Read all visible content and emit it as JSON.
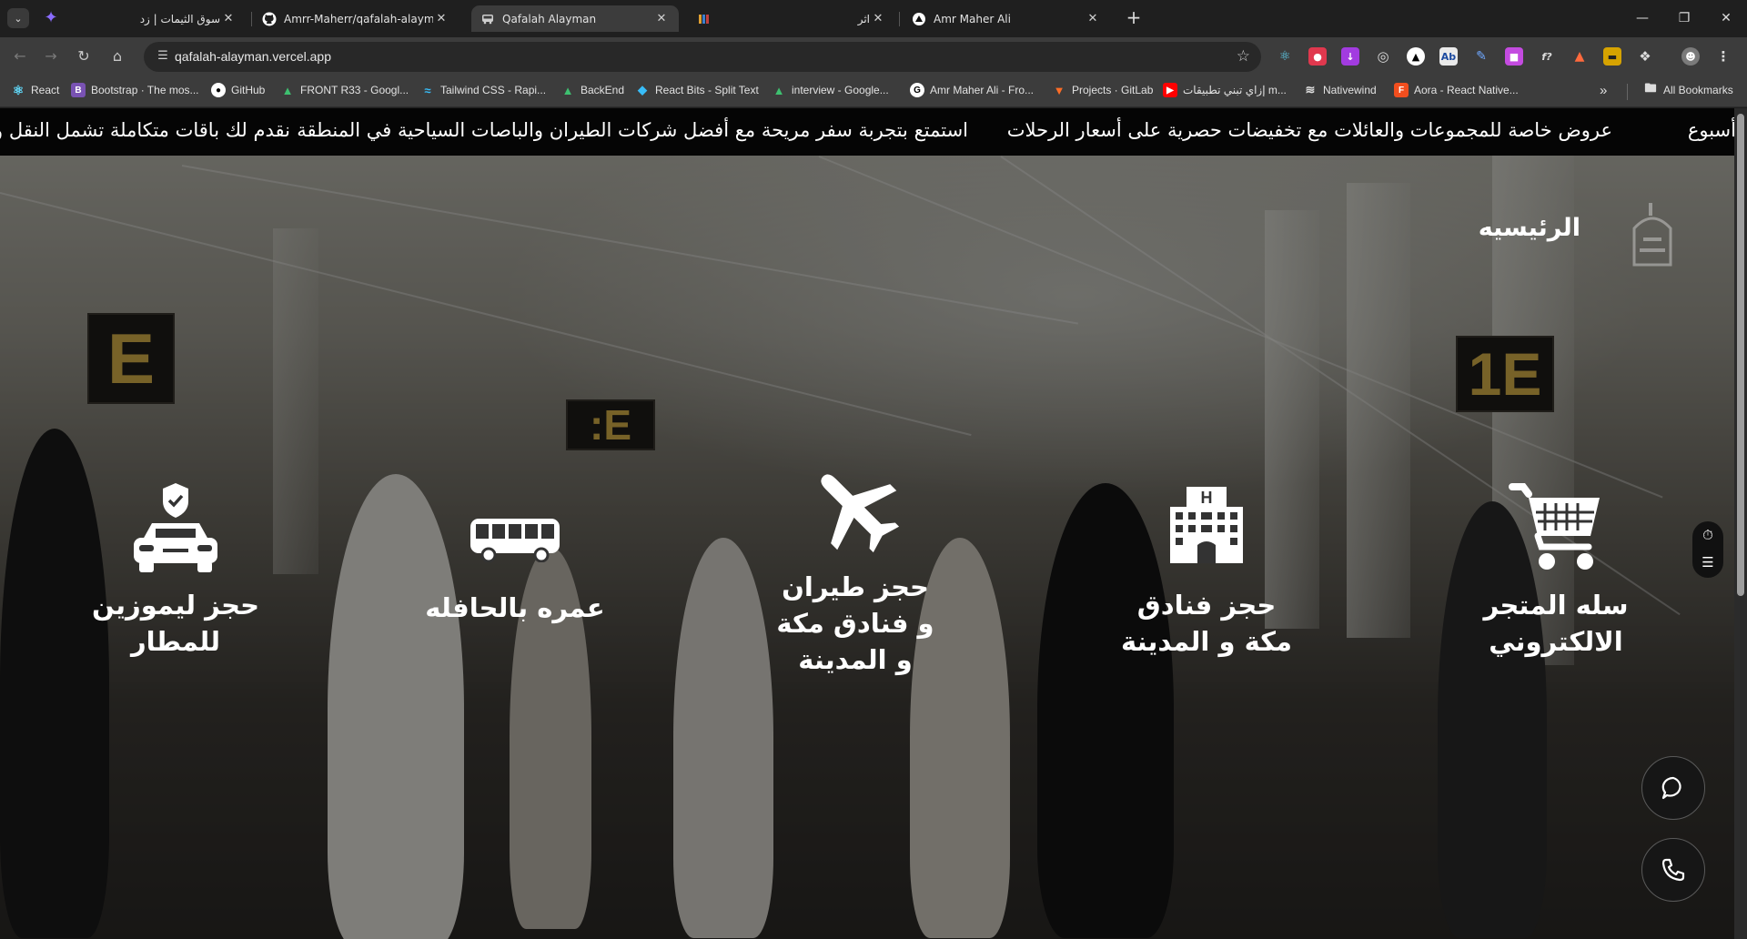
{
  "browser": {
    "tabs": [
      {
        "title": "سوق الثيمات | زد",
        "active": false
      },
      {
        "title": "Amrr-Maherr/qafalah-alayman",
        "active": false
      },
      {
        "title": "Qafalah Alayman",
        "active": true
      },
      {
        "title": "اثر",
        "active": false
      },
      {
        "title": "Amr Maher Ali",
        "active": false
      }
    ],
    "url": "qafalah-alayman.vercel.app",
    "bookmarks": [
      "React",
      "Bootstrap · The mos...",
      "GitHub",
      "FRONT R33 - Googl...",
      "Tailwind CSS - Rapi...",
      "BackEnd",
      "React Bits - Split Text",
      "interview - Google...",
      "Amr Maher Ali - Fro...",
      "Projects · GitLab",
      "إزاي تبني تطبيقات m...",
      "Nativewind",
      "Aora - React Native...",
      "All Bookmarks"
    ]
  },
  "ticker": [
    "نقدم لك باقات متكاملة تشمل النقل والإ",
    "استمتع بتجربة سفر مريحة مع أفضل شركات الطيران والباصات السياحية في المنطقة",
    "عروض خاصة للمجموعات والعائلات مع تخفيضات حصرية على أسعار الرحلات",
    "أسبوع"
  ],
  "nav": {
    "home": "الرئيسيه"
  },
  "signs": [
    "E",
    ":E",
    "1E"
  ],
  "services": [
    {
      "label": "حجز ليموزين للمطار",
      "icon": "car-shield-icon"
    },
    {
      "label": "عمره بالحافله",
      "icon": "bus-icon"
    },
    {
      "label": "حجز طيران و فنادق مكة و المدينة",
      "icon": "airplane-icon"
    },
    {
      "label": "حجز فنادق مكة و المدينة",
      "icon": "hotel-icon"
    },
    {
      "label": "سله المتجر الالكتروني",
      "icon": "cart-icon"
    }
  ]
}
